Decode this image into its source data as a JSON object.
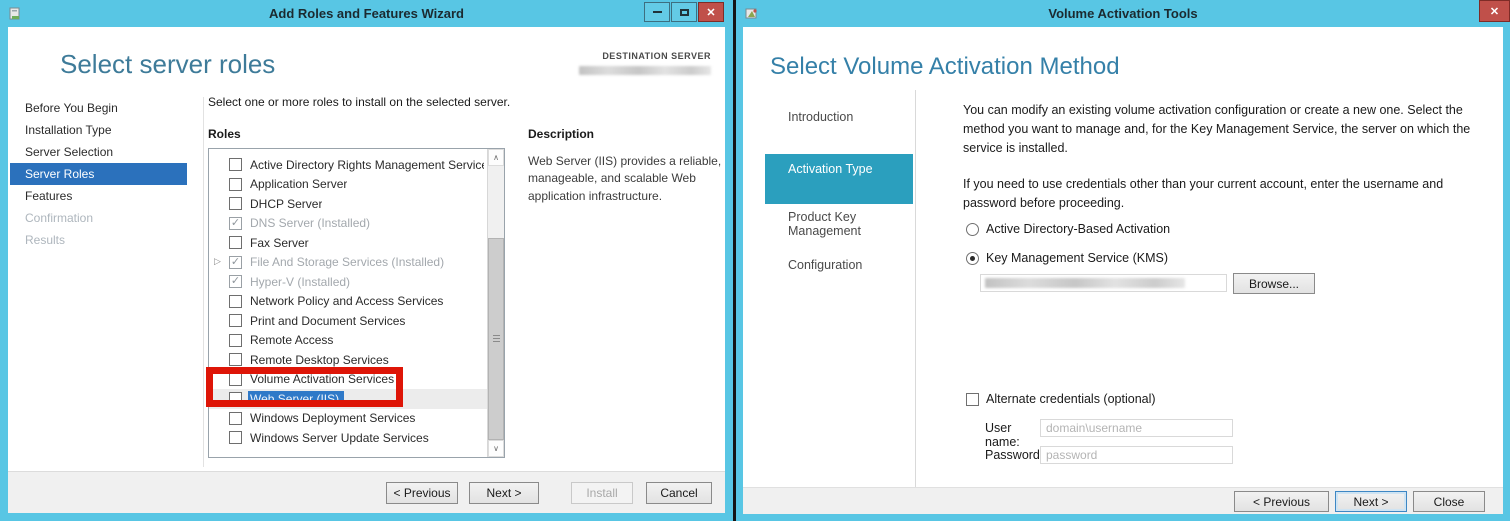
{
  "icons": {
    "close": "✕",
    "check": "✓",
    "expander": "▷",
    "scroll_up": "∧",
    "scroll_down": "∨"
  },
  "colors": {
    "titlebar": "#58c6e4",
    "nav_selected_blue": "#2b71bc",
    "sidebar_selected_teal": "#2b9fbe",
    "annotation_red": "#de1507",
    "close_button_red": "#c0504a",
    "heading_teal": "#3e7b99"
  },
  "left": {
    "title": "Add Roles and Features Wizard",
    "heading": "Select server roles",
    "destination_label": "DESTINATION SERVER",
    "nav": [
      {
        "label": "Before You Begin",
        "state": "normal"
      },
      {
        "label": "Installation Type",
        "state": "normal"
      },
      {
        "label": "Server Selection",
        "state": "normal"
      },
      {
        "label": "Server Roles",
        "state": "selected"
      },
      {
        "label": "Features",
        "state": "normal"
      },
      {
        "label": "Confirmation",
        "state": "disabled"
      },
      {
        "label": "Results",
        "state": "disabled"
      }
    ],
    "instruction": "Select one or more roles to install on the selected server.",
    "roles_label": "Roles",
    "roles": [
      {
        "label": "Active Directory Rights Management Services",
        "checked": false
      },
      {
        "label": "Application Server",
        "checked": false
      },
      {
        "label": "DHCP Server",
        "checked": false
      },
      {
        "label": "DNS Server (Installed)",
        "checked": true
      },
      {
        "label": "Fax Server",
        "checked": false
      },
      {
        "label": "File And Storage Services (Installed)",
        "checked": true,
        "expandable": true
      },
      {
        "label": "Hyper-V (Installed)",
        "checked": true
      },
      {
        "label": "Network Policy and Access Services",
        "checked": false
      },
      {
        "label": "Print and Document Services",
        "checked": false
      },
      {
        "label": "Remote Access",
        "checked": false
      },
      {
        "label": "Remote Desktop Services",
        "checked": false
      },
      {
        "label": "Volume Activation Services",
        "checked": false,
        "annotated": true
      },
      {
        "label": "Web Server (IIS)",
        "checked": false,
        "selected": true
      },
      {
        "label": "Windows Deployment Services",
        "checked": false
      },
      {
        "label": "Windows Server Update Services",
        "checked": false
      }
    ],
    "description_title": "Description",
    "description_text": "Web Server (IIS) provides a reliable, manageable, and scalable Web application infrastructure.",
    "buttons": {
      "previous": "< Previous",
      "next": "Next >",
      "install": "Install",
      "cancel": "Cancel"
    }
  },
  "right": {
    "title": "Volume Activation Tools",
    "heading": "Select Volume Activation Method",
    "nav": [
      {
        "label": "Introduction",
        "state": "normal"
      },
      {
        "label": "Activation Type",
        "state": "selected"
      },
      {
        "label": "Product Key Management",
        "state": "normal"
      },
      {
        "label": "Configuration",
        "state": "normal"
      }
    ],
    "para1": "You can modify an existing volume activation configuration or create a new one. Select the method you want to manage and, for the Key Management Service, the server on which the service is installed.",
    "para2": "If you need to use credentials other than your current account, enter the username and password before proceeding.",
    "radio_ad_label": "Active Directory-Based Activation",
    "radio_kms_label": "Key Management Service (KMS)",
    "radio_selected": "Key Management Service (KMS)",
    "browse_label": "Browse...",
    "alt_credentials_label": "Alternate credentials (optional)",
    "username_label": "User name:",
    "username_placeholder": "domain\\username",
    "password_label": "Password:",
    "password_placeholder": "password",
    "buttons": {
      "previous": "< Previous",
      "next": "Next >",
      "close": "Close"
    }
  }
}
